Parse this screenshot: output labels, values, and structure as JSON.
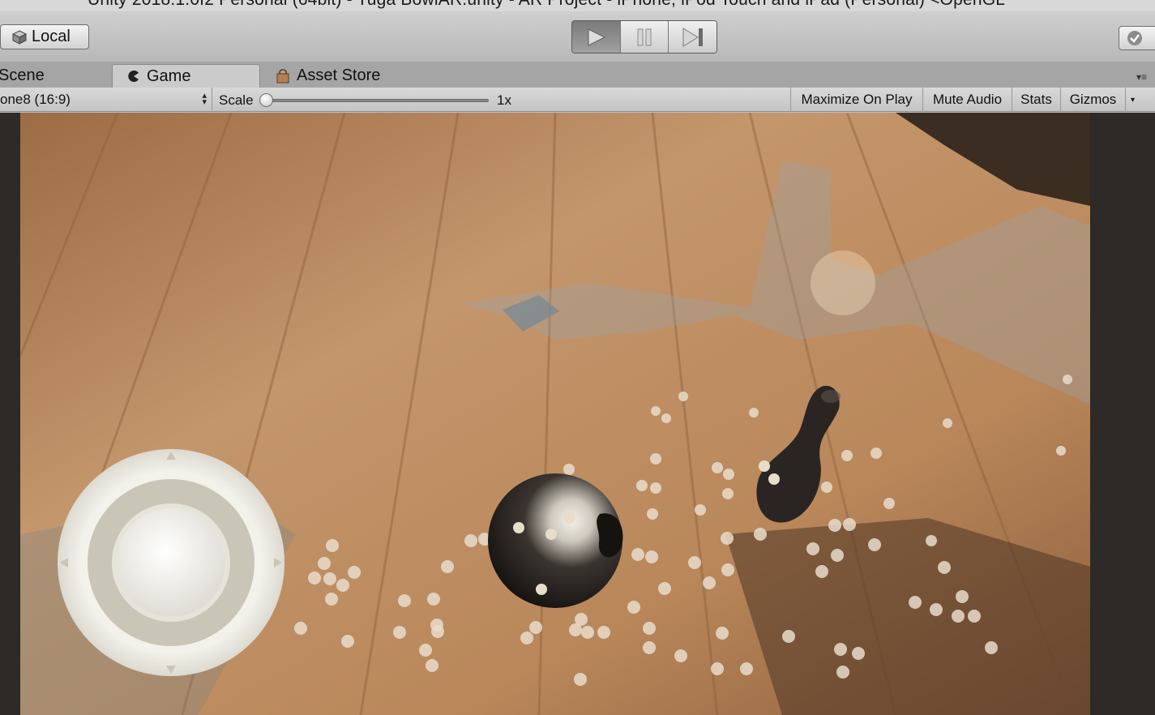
{
  "window": {
    "title": "Unity 2018.1.0f2 Personal (64bit) - Tuga BowlAR.unity - AR Project - iPhone, iPod Touch and iPad (Personal) <OpenGL"
  },
  "toolbar": {
    "local_label": "Local",
    "play_icon": "play-icon",
    "pause_icon": "pause-icon",
    "step_icon": "step-icon"
  },
  "tabs": [
    {
      "label": "Scene",
      "icon": "scene-icon",
      "active": false
    },
    {
      "label": "Game",
      "icon": "game-pacman-icon",
      "active": true
    },
    {
      "label": "Asset Store",
      "icon": "asset-store-bag-icon",
      "active": false
    }
  ],
  "game_toolbar": {
    "resolution": "one8 (16:9)",
    "scale_label": "Scale",
    "scale_value": "1x",
    "scale_fraction": 0.0,
    "maximize_on_play": "Maximize On Play",
    "mute_audio": "Mute Audio",
    "stats": "Stats",
    "gizmos": "Gizmos"
  },
  "game_view": {
    "description_icons": [
      "joystick-control",
      "bowling-ball",
      "bowling-pin",
      "feature-points"
    ]
  },
  "colors": {
    "toolbar_bg": "#c4c4c4",
    "floor_wood": "#b98a5e",
    "ball_dark": "#1c1917",
    "joystick": "#c9c6b8"
  }
}
